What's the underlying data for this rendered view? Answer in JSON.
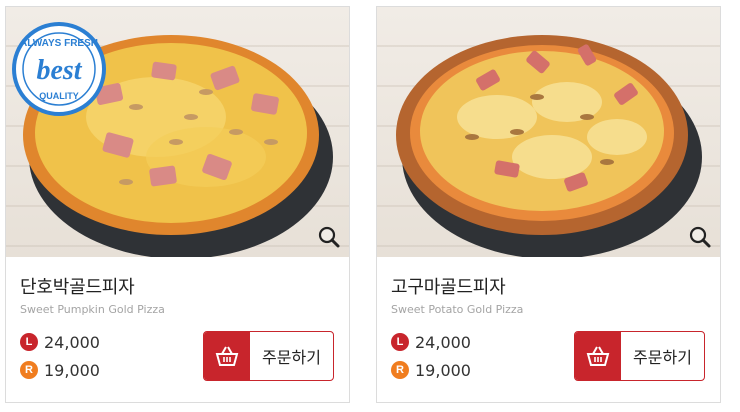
{
  "colors": {
    "accent_red": "#c8252c",
    "accent_orange": "#f07d1f",
    "border": "#dcdcdc"
  },
  "products": [
    {
      "name": "단호박골드피자",
      "english_name": "Sweet Pumpkin Gold Pizza",
      "price_large_badge": "L",
      "price_large": "24,000",
      "price_regular_badge": "R",
      "price_regular": "19,000",
      "order_label": "주문하기",
      "badge": {
        "top_text": "ALWAYS FRESH",
        "main_text": "best",
        "bottom_text": "QUALITY"
      },
      "zoom_icon": "magnifier-icon",
      "cart_icon": "basket-icon"
    },
    {
      "name": "고구마골드피자",
      "english_name": "Sweet Potato Gold Pizza",
      "price_large_badge": "L",
      "price_large": "24,000",
      "price_regular_badge": "R",
      "price_regular": "19,000",
      "order_label": "주문하기",
      "zoom_icon": "magnifier-icon",
      "cart_icon": "basket-icon"
    }
  ]
}
